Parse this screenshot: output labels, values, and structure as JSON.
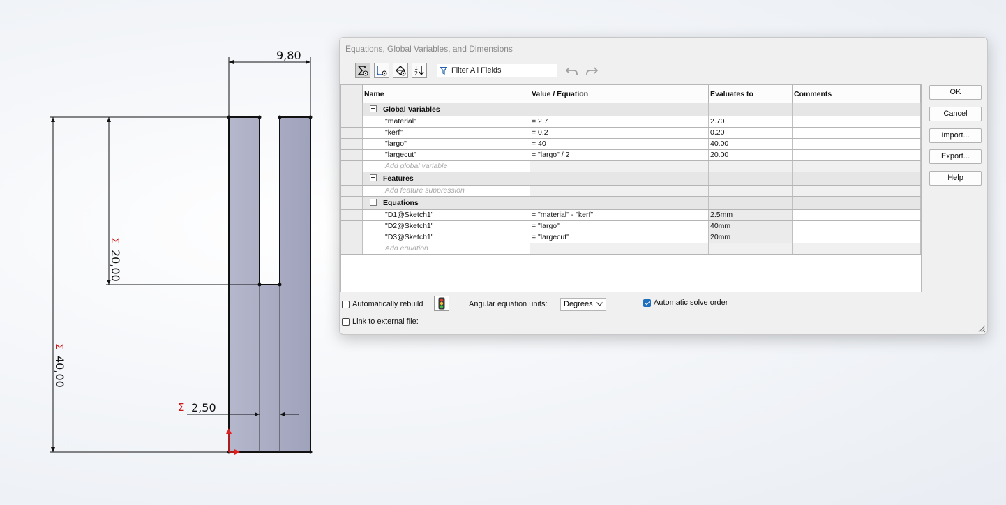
{
  "sketch": {
    "dim_top": "9,80",
    "dim_inner": "20,00",
    "dim_outer": "40,00",
    "dim_gap": "2,50",
    "sigma": "Σ"
  },
  "dialog": {
    "title": "Equations, Global Variables, and Dimensions",
    "filter_placeholder": "Filter All Fields",
    "toolbar_icons": [
      "equation-view-icon",
      "sketch-equation-view-icon",
      "dimension-view-icon",
      "ordered-view-icon"
    ],
    "columns": [
      "Name",
      "Value / Equation",
      "Evaluates to",
      "Comments"
    ],
    "sections": {
      "global": {
        "title": "Global Variables",
        "rows": [
          {
            "name": "\"material\"",
            "value": "= 2.7",
            "eval": "2.70",
            "comment": ""
          },
          {
            "name": "\"kerf\"",
            "value": "= 0.2",
            "eval": "0.20",
            "comment": ""
          },
          {
            "name": "\"largo\"",
            "value": "= 40",
            "eval": "40.00",
            "comment": ""
          },
          {
            "name": "\"largecut\"",
            "value": "= \"largo\" / 2",
            "eval": "20.00",
            "comment": ""
          }
        ],
        "add": "Add global variable"
      },
      "features": {
        "title": "Features",
        "add": "Add feature suppression"
      },
      "equations": {
        "title": "Equations",
        "rows": [
          {
            "name": "\"D1@Sketch1\"",
            "value": "= \"material\" - \"kerf\"",
            "eval": "2.5mm",
            "comment": ""
          },
          {
            "name": "\"D2@Sketch1\"",
            "value": "= \"largo\"",
            "eval": "40mm",
            "comment": ""
          },
          {
            "name": "\"D3@Sketch1\"",
            "value": "= \"largecut\"",
            "eval": "20mm",
            "comment": ""
          }
        ],
        "add": "Add equation"
      }
    },
    "buttons": {
      "ok": "OK",
      "cancel": "Cancel",
      "import": "Import...",
      "export": "Export...",
      "help": "Help"
    },
    "options": {
      "auto_rebuild": "Automatically rebuild",
      "link_external": "Link to external file:",
      "angular_label": "Angular equation units:",
      "angular_value": "Degrees",
      "auto_solve": "Automatic solve order"
    },
    "colors": {
      "accent": "#1f6fbf",
      "part_fill": "#a9abc3"
    }
  }
}
